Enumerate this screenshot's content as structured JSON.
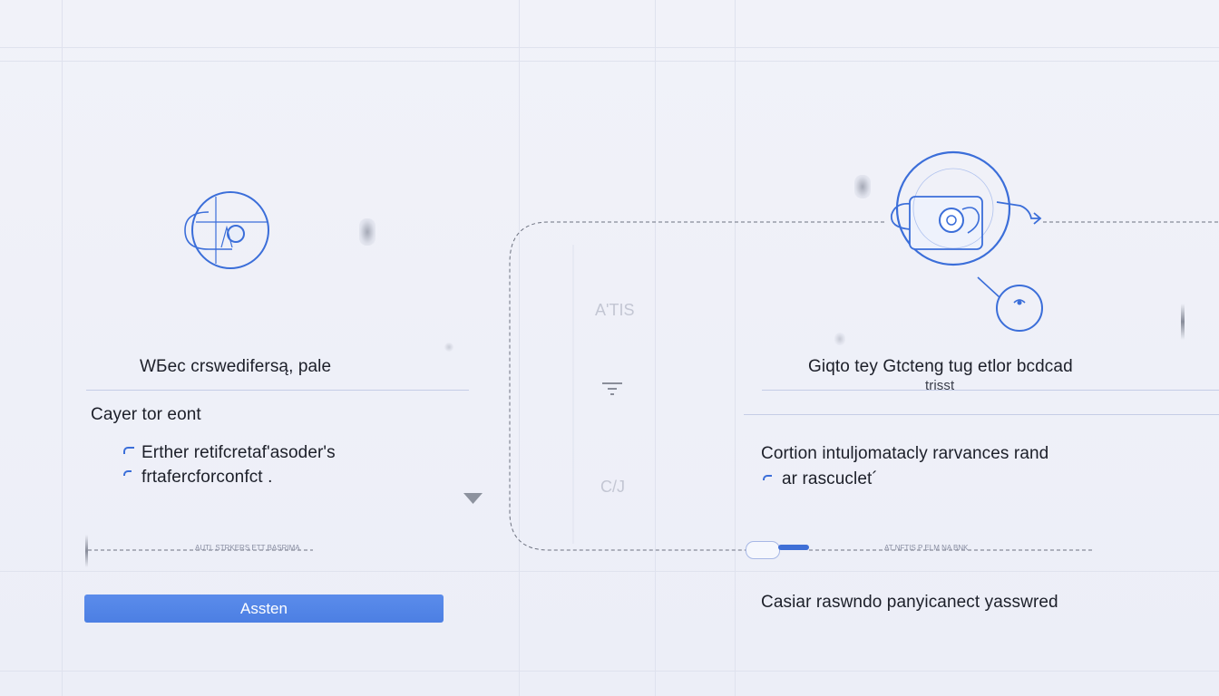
{
  "left_panel": {
    "title": "WБec crswedifersą, pale",
    "section_label": "Cayer tor eont",
    "items": [
      "Erther retifcretaf'asoder's",
      "frtafercforconfct ."
    ],
    "footer_text": "AUTL STRKERS ETT BASRIMA",
    "button_label": "Assten"
  },
  "middle_panel": {
    "label_top": "A'TIS",
    "label_bottom": "C/J"
  },
  "right_panel": {
    "title": "Giqto tey Gtcteng tug etlor bcdcad",
    "subtitle": "trisst",
    "description_line1": "Cortion intuljomatacly rarvances rand",
    "description_line2": "ar rascuclet´",
    "footer_text": "AT NFTIS P ELM NA BNK",
    "bottom_text": "Casiar raswndo panyicanect yasswred"
  },
  "colors": {
    "accent": "#3b6ed9",
    "button": "#5085e6",
    "background": "#eef0f8",
    "divider": "#c5cde6"
  },
  "icons": {
    "left_illustration": "profile-circle-icon",
    "right_illustration": "user-avatar-illustration-icon",
    "small_circle": "circle-badge-icon",
    "dropdown": "chevron-down-icon",
    "filter": "filter-icon"
  }
}
